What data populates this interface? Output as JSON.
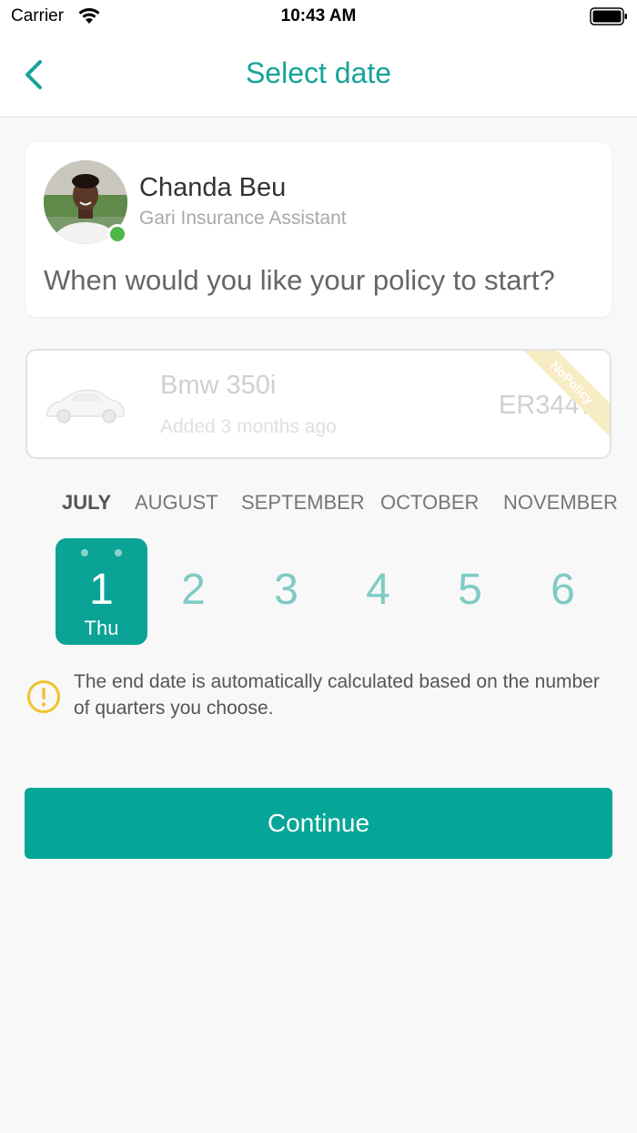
{
  "status_bar": {
    "carrier": "Carrier",
    "time": "10:43 AM"
  },
  "nav": {
    "title": "Select date",
    "back_icon": "chevron-left-icon"
  },
  "assistant": {
    "name": "Chanda Beu",
    "role": "Gari Insurance Assistant",
    "question": "When would you like your policy to start?",
    "online": true
  },
  "vehicle": {
    "name": "Bmw 350i",
    "added": "Added 3 months ago",
    "plate": "ER3447",
    "ribbon": "NoPolicy",
    "icon": "car-icon"
  },
  "months": [
    "JULY",
    "AUGUST",
    "SEPTEMBER",
    "OCTOBER",
    "NOVEMBER"
  ],
  "selected_month": "JULY",
  "days": [
    {
      "number": "1",
      "weekday": "Thu",
      "selected": true
    },
    {
      "number": "2"
    },
    {
      "number": "3"
    },
    {
      "number": "4"
    },
    {
      "number": "5"
    },
    {
      "number": "6"
    }
  ],
  "info": {
    "text": "The end date is automatically calculated based on the number of quarters you choose.",
    "icon": "warning-icon"
  },
  "continue_label": "Continue",
  "colors": {
    "accent": "#16a398",
    "button": "#05a597",
    "online": "#4cb648",
    "warning": "#f2c12e"
  }
}
